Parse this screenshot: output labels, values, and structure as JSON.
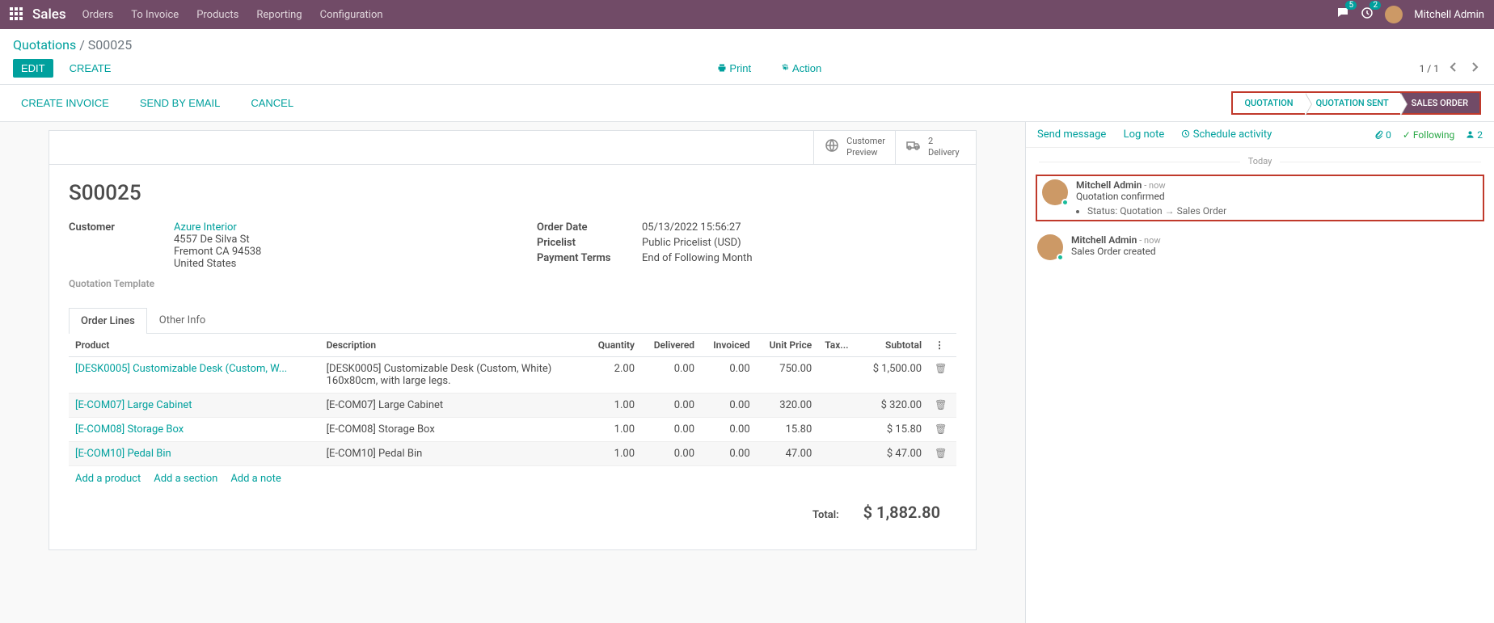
{
  "nav": {
    "brand": "Sales",
    "menu": [
      "Orders",
      "To Invoice",
      "Products",
      "Reporting",
      "Configuration"
    ],
    "msg_count": "5",
    "activity_count": "2",
    "user": "Mitchell Admin"
  },
  "breadcrumb": {
    "root": "Quotations",
    "current": "S00025"
  },
  "buttons": {
    "edit": "EDIT",
    "create": "CREATE",
    "print": "Print",
    "action": "Action"
  },
  "pager": {
    "text": "1 / 1"
  },
  "actions": {
    "create_invoice": "CREATE INVOICE",
    "send_email": "SEND BY EMAIL",
    "cancel": "CANCEL"
  },
  "status": {
    "s1": "QUOTATION",
    "s2": "QUOTATION SENT",
    "s3": "SALES ORDER"
  },
  "stat": {
    "preview1": "Customer",
    "preview2": "Preview",
    "deliv1": "2",
    "deliv2": "Delivery"
  },
  "record": {
    "name": "S00025",
    "labels": {
      "customer": "Customer",
      "template": "Quotation Template",
      "order_date": "Order Date",
      "pricelist": "Pricelist",
      "payment_terms": "Payment Terms"
    },
    "customer_name": "Azure Interior",
    "addr1": "4557 De Silva St",
    "addr2": "Fremont CA 94538",
    "addr3": "United States",
    "order_date": "05/13/2022 15:56:27",
    "pricelist": "Public Pricelist (USD)",
    "payment_terms": "End of Following Month"
  },
  "tabs": {
    "lines": "Order Lines",
    "other": "Other Info"
  },
  "cols": {
    "product": "Product",
    "desc": "Description",
    "qty": "Quantity",
    "delivered": "Delivered",
    "invoiced": "Invoiced",
    "price": "Unit Price",
    "tax": "Tax...",
    "subtotal": "Subtotal"
  },
  "lines": [
    {
      "product": "[DESK0005] Customizable Desk (Custom, W...",
      "desc": "[DESK0005] Customizable Desk (Custom, White)\n160x80cm, with large legs.",
      "qty": "2.00",
      "delivered": "0.00",
      "invoiced": "0.00",
      "price": "750.00",
      "subtotal": "$ 1,500.00"
    },
    {
      "product": "[E-COM07] Large Cabinet",
      "desc": "[E-COM07] Large Cabinet",
      "qty": "1.00",
      "delivered": "0.00",
      "invoiced": "0.00",
      "price": "320.00",
      "subtotal": "$ 320.00"
    },
    {
      "product": "[E-COM08] Storage Box",
      "desc": "[E-COM08] Storage Box",
      "qty": "1.00",
      "delivered": "0.00",
      "invoiced": "0.00",
      "price": "15.80",
      "subtotal": "$ 15.80"
    },
    {
      "product": "[E-COM10] Pedal Bin",
      "desc": "[E-COM10] Pedal Bin",
      "qty": "1.00",
      "delivered": "0.00",
      "invoiced": "0.00",
      "price": "47.00",
      "subtotal": "$ 47.00"
    }
  ],
  "add": {
    "product": "Add a product",
    "section": "Add a section",
    "note": "Add a note"
  },
  "total": {
    "label": "Total:",
    "value": "$ 1,882.80"
  },
  "chatter": {
    "send": "Send message",
    "log": "Log note",
    "schedule": "Schedule activity",
    "attach": "0",
    "following": "Following",
    "followers": "2",
    "today": "Today",
    "msg1": {
      "author": "Mitchell Admin",
      "time": "- now",
      "text": "Quotation confirmed",
      "bullet_prefix": "Status: ",
      "from": "Quotation",
      "to": "Sales Order"
    },
    "msg2": {
      "author": "Mitchell Admin",
      "time": "- now",
      "text": "Sales Order created"
    }
  }
}
